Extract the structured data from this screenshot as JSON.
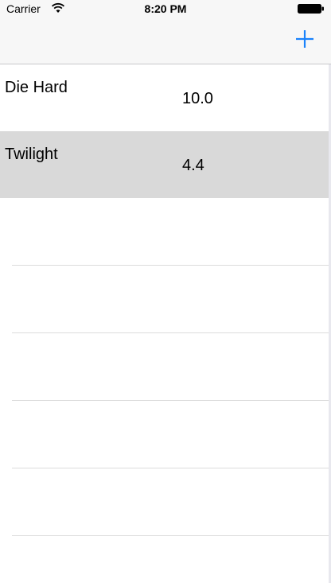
{
  "status_bar": {
    "carrier": "Carrier",
    "time": "8:20 PM"
  },
  "nav": {
    "add_icon": "plus-icon",
    "accent_color": "#1a82fb"
  },
  "movies": [
    {
      "title": "Die Hard",
      "rating": "10.0",
      "selected": false
    },
    {
      "title": "Twilight",
      "rating": "4.4",
      "selected": true
    }
  ],
  "colors": {
    "selected_row": "#d9d9d9",
    "bar_background": "#f7f7f7"
  }
}
